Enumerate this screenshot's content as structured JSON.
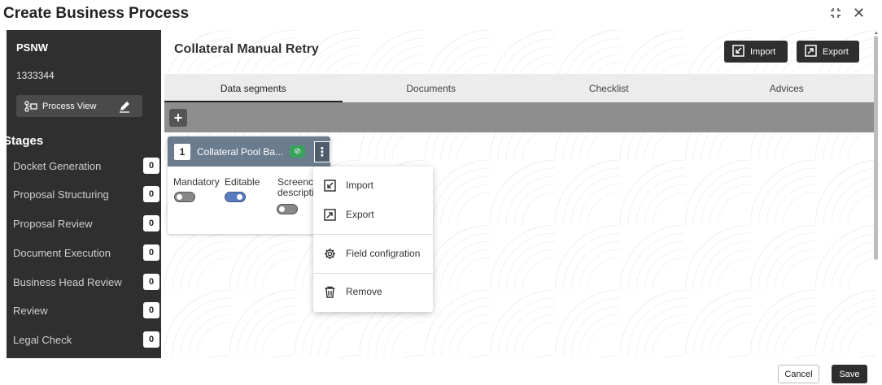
{
  "header": {
    "title": "Create Business Process"
  },
  "window": {
    "restore_icon": "restore-icon",
    "close_icon": "close-icon",
    "close_glyph": "✕"
  },
  "sidebar": {
    "code": "PSNW",
    "number": "1333344",
    "process_view_label": "Process View",
    "stages_heading": "Stages",
    "stages": [
      {
        "label": "Docket Generation",
        "count": "0"
      },
      {
        "label": "Proposal Structuring",
        "count": "0"
      },
      {
        "label": "Proposal Review",
        "count": "0"
      },
      {
        "label": "Document Execution",
        "count": "0"
      },
      {
        "label": "Business Head Review",
        "count": "0"
      },
      {
        "label": "Review",
        "count": "0"
      },
      {
        "label": "Legal Check",
        "count": "0"
      }
    ]
  },
  "main": {
    "title": "Collateral Manual Retry",
    "import_label": "Import",
    "export_label": "Export",
    "tabs": [
      {
        "label": "Data segments",
        "active": true
      },
      {
        "label": "Documents",
        "active": false
      },
      {
        "label": "Checklist",
        "active": false
      },
      {
        "label": "Advices",
        "active": false
      }
    ],
    "add_glyph": "+"
  },
  "card": {
    "sequence": "1",
    "name": "Collateral Pool Ba...",
    "status_glyph": "⊘",
    "kebab_glyph": "⋮",
    "fields": {
      "mandatory_label": "Mandatory",
      "mandatory_on": false,
      "editable_label": "Editable",
      "editable_on": true,
      "screenshot_label_line1": "Screencl",
      "screenshot_label_line2": "descripti",
      "screenshot_on": false
    }
  },
  "context_menu": {
    "items": [
      {
        "label": "Import",
        "icon": "import-icon"
      },
      {
        "label": "Export",
        "icon": "export-icon"
      },
      {
        "label": "Field configration",
        "icon": "gear-icon"
      },
      {
        "label": "Remove",
        "icon": "trash-icon"
      }
    ]
  },
  "footer": {
    "cancel_label": "Cancel",
    "save_label": "Save"
  },
  "colors": {
    "sidebar_bg": "#2f2f2f",
    "card_header": "#6b7c8f",
    "status_green": "#3aa35b",
    "toggle_on": "#5b7bbf",
    "toolbar_gray": "#8e8e8e",
    "button_dark": "#2e2e2e"
  }
}
